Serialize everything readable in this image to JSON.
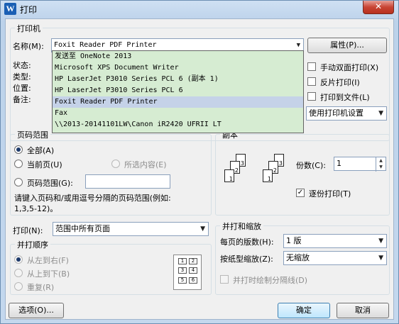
{
  "window": {
    "title": "打印",
    "app_icon": "W",
    "close_glyph": "✕"
  },
  "printer": {
    "group_title": "打印机",
    "name_label": "名称(M):",
    "selected": "Foxit Reader PDF Printer",
    "properties_button": "属性(P)...",
    "status_label": "状态:",
    "type_label": "类型:",
    "location_label": "位置:",
    "comment_label": "备注:",
    "options": [
      "发送至 OneNote 2013",
      "Microsoft XPS Document Writer",
      "HP LaserJet P3010 Series PCL 6 (副本 1)",
      "HP LaserJet P3010 Series PCL 6",
      "Foxit Reader PDF Printer",
      "Fax",
      "\\\\2013-20141101LW\\Canon iR2420 UFRII LT"
    ],
    "manual_duplex": "手动双面打印(X)",
    "reverse_print": "反片打印(I)",
    "print_to_file": "打印到文件(L)",
    "use_printer_settings": "使用打印机设置"
  },
  "page_range": {
    "group_title": "页码范围",
    "all": "全部(A)",
    "current": "当前页(U)",
    "selection": "所选内容(E)",
    "pages": "页码范围(G):",
    "hint_line1": "请键入页码和/或用逗号分隔的页码范围(例如:",
    "hint_line2": "1,3,5-12)。",
    "pages_value": ""
  },
  "copies": {
    "group_title": "副本",
    "count_label": "份数(C):",
    "count_value": "1",
    "collate_label": "逐份打印(T)",
    "collate_checked": true
  },
  "print_what": {
    "label": "打印(N):",
    "value": "范围中所有页面"
  },
  "order": {
    "group_title": "并打顺序",
    "left_to_right": "从左到右(F)",
    "top_to_bottom": "从上到下(B)",
    "repeat": "重复(R)"
  },
  "zoom": {
    "group_title": "并打和缩放",
    "pages_per_sheet_label": "每页的版数(H):",
    "pages_per_sheet_value": "1 版",
    "scale_label": "按纸型缩放(Z):",
    "scale_value": "无缩放",
    "draw_borders": "并打时绘制分隔线(D)"
  },
  "buttons": {
    "options": "选项(O)...",
    "ok": "确定",
    "cancel": "取消"
  }
}
